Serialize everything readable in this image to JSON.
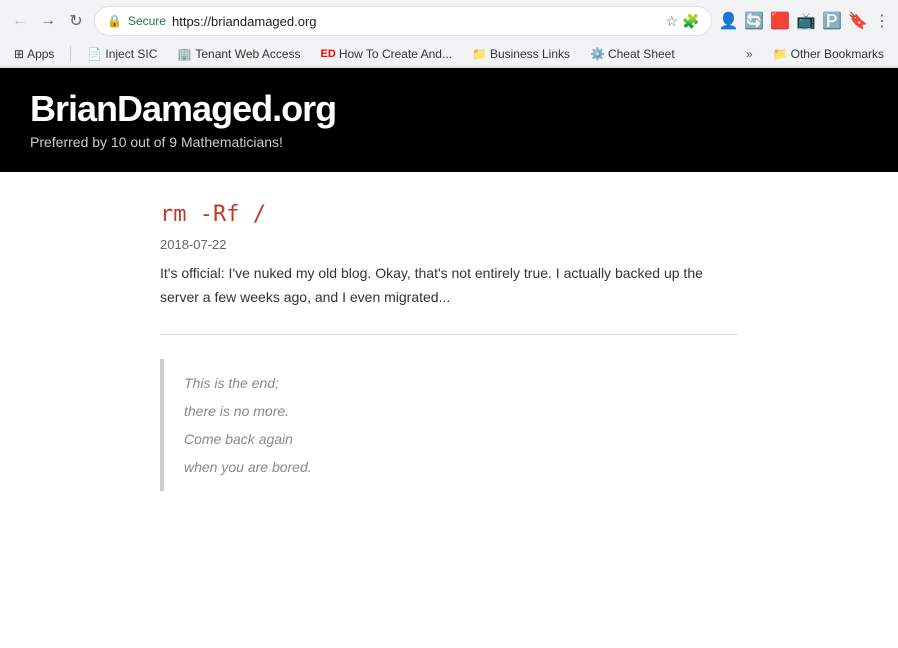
{
  "browser": {
    "url": "https://briandamaged.org",
    "secure_label": "Secure",
    "url_display": "https://briandamaged.org"
  },
  "bookmarks": {
    "apps_label": "Apps",
    "items": [
      {
        "id": "inject-sic",
        "label": "Inject SIC",
        "icon": "📄"
      },
      {
        "id": "tenant-web-access",
        "label": "Tenant Web Access",
        "icon": "🏢"
      },
      {
        "id": "how-to-create",
        "label": "How To Create And...",
        "icon": "🔴"
      },
      {
        "id": "business-links",
        "label": "Business Links",
        "icon": "📁"
      },
      {
        "id": "cheat-sheet",
        "label": "Cheat Sheet",
        "icon": "⚙️"
      }
    ],
    "more_label": "»",
    "other_label": "Other Bookmarks"
  },
  "site": {
    "title": "BrianDamaged.org",
    "tagline": "Preferred by 10 out of 9 Mathematicians!"
  },
  "post": {
    "title": "rm -Rf /",
    "date": "2018-07-22",
    "excerpt": "It's official: I've nuked my old blog. Okay, that's not entirely true. I actually backed up the server a few weeks ago, and I even migrated...",
    "blockquote_line1": "This is the end;",
    "blockquote_line2": "there is no more.",
    "blockquote_line3": "Come back again",
    "blockquote_line4": "when you are bored."
  }
}
